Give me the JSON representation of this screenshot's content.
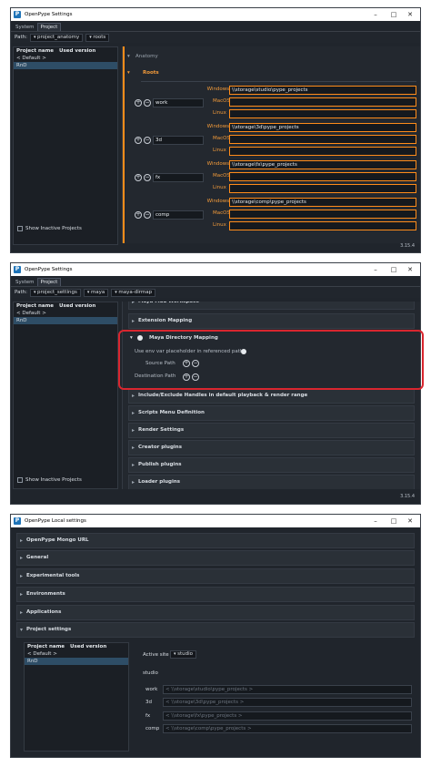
{
  "win1": {
    "title": "OpenPype Settings",
    "tabs": [
      "System",
      "Project"
    ],
    "path_label": "Path:",
    "path_segments": [
      "project_anatomy",
      "roots"
    ],
    "project_col": "Project name",
    "version_col": "Used version",
    "projects": [
      "< Default >",
      "RnD"
    ],
    "show_inactive": "Show Inactive Projects",
    "anatomy_label": "Anatomy",
    "roots_label": "Roots",
    "roots": [
      {
        "name": "work",
        "windows": "\\\\storage\\studio\\pype_projects",
        "macos": "",
        "linux": ""
      },
      {
        "name": "3d",
        "windows": "\\\\storage\\3d\\pype_projects",
        "macos": "",
        "linux": ""
      },
      {
        "name": "fx",
        "windows": "\\\\storage\\fx\\pype_projects",
        "macos": "",
        "linux": ""
      },
      {
        "name": "comp",
        "windows": "\\\\storage\\comp\\pype_projects",
        "macos": "",
        "linux": ""
      }
    ],
    "os_labels": [
      "Windows",
      "MacOS",
      "Linux"
    ],
    "version": "3.15.4"
  },
  "win2": {
    "title": "OpenPype Settings",
    "tabs": [
      "System",
      "Project"
    ],
    "path_label": "Path:",
    "path_segments": [
      "project_settings",
      "maya",
      "maya-dirmap"
    ],
    "project_col": "Project name",
    "version_col": "Used version",
    "projects": [
      "< Default >",
      "RnD"
    ],
    "show_inactive": "Show Inactive Projects",
    "top_cut": "Maya MSL Workspace",
    "extension_mapping": "Extension Mapping",
    "dirmap_title": "Maya Directory Mapping",
    "env_var_label": "Use env var placeholder in referenced paths",
    "source_path": "Source Path",
    "destination_path": "Destination Path",
    "sections": [
      "Include/Exclude Handles in default playback & render range",
      "Scripts Menu Definition",
      "Render Settings",
      "Creator plugins",
      "Publish plugins",
      "Loader plugins"
    ],
    "version": "3.15.4"
  },
  "win3": {
    "title": "OpenPype Local settings",
    "sections": [
      "OpenPype Mongo URL",
      "General",
      "Experimental tools",
      "Environments",
      "Applications",
      "Project settings"
    ],
    "project_col": "Project name",
    "version_col": "Used version",
    "projects": [
      "< Default >",
      "RnD"
    ],
    "active_site_label": "Active site",
    "active_site_value": "studio",
    "site_header": "studio",
    "roots": [
      {
        "name": "work",
        "value": "< \\\\storage\\studio\\pype_projects >"
      },
      {
        "name": "3d",
        "value": "< \\\\storage\\3d\\pype_projects >"
      },
      {
        "name": "fx",
        "value": "< \\\\storage\\fx\\pype_projects >"
      },
      {
        "name": "comp",
        "value": "< \\\\storage\\comp\\pype_projects >"
      }
    ]
  },
  "colors": {
    "accent": "#ff8c1a",
    "selection": "#2e4d66",
    "highlight": "#d9262f"
  }
}
